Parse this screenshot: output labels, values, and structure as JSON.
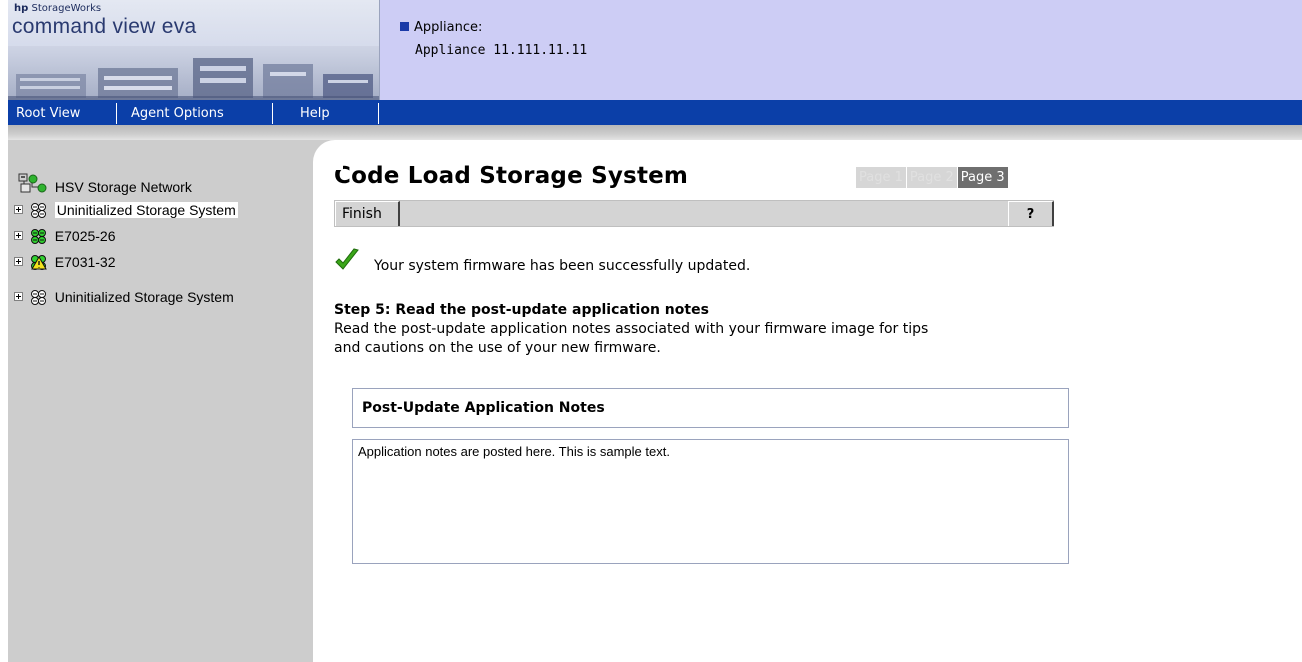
{
  "header": {
    "brand_small": "StorageWorks",
    "brand_hp": "hp",
    "brand_name": "command view eva",
    "appliance_label": "Appliance:",
    "appliance_value": "Appliance 11.111.11.11",
    "accent_color": "#0b3fa8",
    "panel_color": "#cdcdf5"
  },
  "menu": {
    "items": [
      {
        "label": "Root View"
      },
      {
        "label": "Agent Options"
      },
      {
        "label": "Help"
      }
    ]
  },
  "sidebar": {
    "root": {
      "label": "HSV Storage Network",
      "icon": "storage-network-icon"
    },
    "items": [
      {
        "label": "Uninitialized Storage System",
        "icon": "storage-system-gray-icon",
        "selected": true
      },
      {
        "label": "E7025-26",
        "icon": "storage-system-green-icon",
        "selected": false
      },
      {
        "label": "E7031-32",
        "icon": "storage-system-warning-icon",
        "selected": false
      },
      {
        "label": "Uninitialized Storage System",
        "icon": "storage-system-gray-icon",
        "selected": false
      }
    ]
  },
  "main": {
    "title": "Code Load Storage System",
    "pages": [
      {
        "label": "Page 1",
        "active": false
      },
      {
        "label": "Page 2",
        "active": false
      },
      {
        "label": "Page 3",
        "active": true
      }
    ],
    "toolbar": {
      "finish_label": "Finish",
      "help_label": "?"
    },
    "success_message": "Your system firmware has been successfully updated.",
    "step_title": "Step 5: Read the post-update application notes",
    "step_desc_line1": "Read the post-update application notes associated with your firmware image for tips",
    "step_desc_line2": "and cautions on the use of your new firmware.",
    "notes_title": "Post-Update Application Notes",
    "notes_body": "Application notes are posted here. This is sample text."
  }
}
